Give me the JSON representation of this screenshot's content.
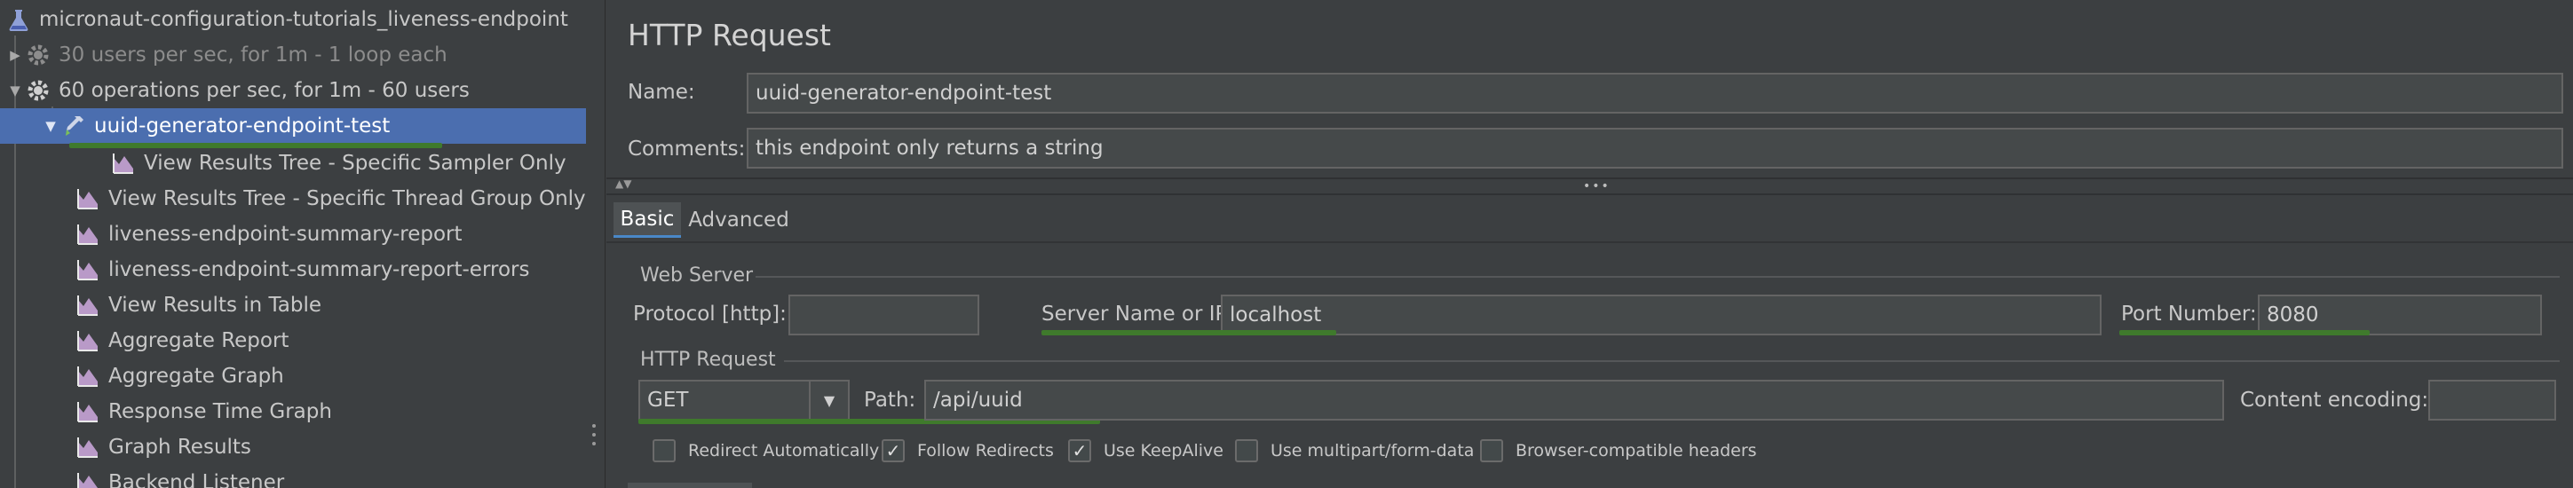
{
  "tree": {
    "items": [
      {
        "label": "micronaut-configuration-tutorials_liveness-endpoint",
        "icon": "flask-icon",
        "arrow": ""
      },
      {
        "label": "30 users per sec, for 1m - 1 loop each",
        "icon": "gear-icon",
        "arrow": "▶"
      },
      {
        "label": "60 operations per sec, for 1m - 60 users",
        "icon": "gear-icon",
        "arrow": "▼"
      },
      {
        "label": "uuid-generator-endpoint-test",
        "icon": "pipette-icon",
        "arrow": "▼"
      },
      {
        "label": "View Results Tree - Specific Sampler Only",
        "icon": "graph-icon",
        "arrow": ""
      },
      {
        "label": "View Results Tree - Specific Thread Group Only",
        "icon": "graph-icon",
        "arrow": ""
      },
      {
        "label": "liveness-endpoint-summary-report",
        "icon": "graph-icon",
        "arrow": ""
      },
      {
        "label": "liveness-endpoint-summary-report-errors",
        "icon": "graph-icon",
        "arrow": ""
      },
      {
        "label": "View Results in Table",
        "icon": "graph-icon",
        "arrow": ""
      },
      {
        "label": "Aggregate Report",
        "icon": "graph-icon",
        "arrow": ""
      },
      {
        "label": "Aggregate Graph",
        "icon": "graph-icon",
        "arrow": ""
      },
      {
        "label": "Response Time Graph",
        "icon": "graph-icon",
        "arrow": ""
      },
      {
        "label": "Graph Results",
        "icon": "graph-icon",
        "arrow": ""
      },
      {
        "label": "Backend Listener",
        "icon": "graph-icon",
        "arrow": ""
      }
    ]
  },
  "form": {
    "title": "HTTP Request",
    "name_label": "Name:",
    "name_value": "uuid-generator-endpoint-test",
    "comments_label": "Comments:",
    "comments_value": "this endpoint only returns a string",
    "tabs": [
      "Basic",
      "Advanced"
    ],
    "web_server": {
      "section_label": "Web Server",
      "protocol_label": "Protocol [http]:",
      "protocol_value": "",
      "server_label": "Server Name or IP:",
      "server_value": "localhost",
      "port_label": "Port Number:",
      "port_value": "8080"
    },
    "http_request": {
      "section_label": "HTTP Request",
      "method_value": "GET",
      "path_label": "Path:",
      "path_value": "/api/uuid",
      "encoding_label": "Content encoding:",
      "encoding_value": ""
    },
    "checkboxes": [
      {
        "label": "Redirect Automatically",
        "checked": false,
        "mark": ""
      },
      {
        "label": "Follow Redirects",
        "checked": true,
        "mark": "✓"
      },
      {
        "label": "Use KeepAlive",
        "checked": true,
        "mark": "✓"
      },
      {
        "label": "Use multipart/form-data",
        "checked": false,
        "mark": ""
      },
      {
        "label": "Browser-compatible headers",
        "checked": false,
        "mark": ""
      }
    ]
  },
  "colors": {
    "selection": "#4b6eaf",
    "underline_green": "#3f7a2c",
    "background": "#3c3f41"
  }
}
